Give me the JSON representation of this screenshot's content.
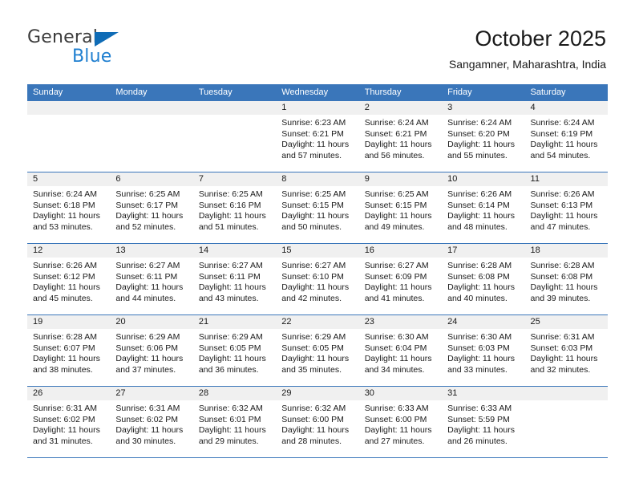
{
  "brand": {
    "name_top": "General",
    "name_bottom": "Blue",
    "triangle_color": "#0f6cb6",
    "blue_color": "#1f7fd0"
  },
  "header": {
    "title": "October 2025",
    "subtitle": "Sangamner, Maharashtra, India"
  },
  "theme": {
    "header_blue": "#3a76ba",
    "day_band_gray": "#f0f0f0",
    "text": "#1a1a1a"
  },
  "weekdays": [
    "Sunday",
    "Monday",
    "Tuesday",
    "Wednesday",
    "Thursday",
    "Friday",
    "Saturday"
  ],
  "labels": {
    "sunrise_prefix": "Sunrise: ",
    "sunset_prefix": "Sunset: ",
    "daylight_prefix": "Daylight: "
  },
  "weeks": [
    [
      {
        "day": "",
        "empty": true
      },
      {
        "day": "",
        "empty": true
      },
      {
        "day": "",
        "empty": true
      },
      {
        "day": "1",
        "sunrise": "Sunrise: 6:23 AM",
        "sunset": "Sunset: 6:21 PM",
        "daylight_line1": "Daylight: 11 hours",
        "daylight_line2": "and 57 minutes."
      },
      {
        "day": "2",
        "sunrise": "Sunrise: 6:24 AM",
        "sunset": "Sunset: 6:21 PM",
        "daylight_line1": "Daylight: 11 hours",
        "daylight_line2": "and 56 minutes."
      },
      {
        "day": "3",
        "sunrise": "Sunrise: 6:24 AM",
        "sunset": "Sunset: 6:20 PM",
        "daylight_line1": "Daylight: 11 hours",
        "daylight_line2": "and 55 minutes."
      },
      {
        "day": "4",
        "sunrise": "Sunrise: 6:24 AM",
        "sunset": "Sunset: 6:19 PM",
        "daylight_line1": "Daylight: 11 hours",
        "daylight_line2": "and 54 minutes."
      }
    ],
    [
      {
        "day": "5",
        "sunrise": "Sunrise: 6:24 AM",
        "sunset": "Sunset: 6:18 PM",
        "daylight_line1": "Daylight: 11 hours",
        "daylight_line2": "and 53 minutes."
      },
      {
        "day": "6",
        "sunrise": "Sunrise: 6:25 AM",
        "sunset": "Sunset: 6:17 PM",
        "daylight_line1": "Daylight: 11 hours",
        "daylight_line2": "and 52 minutes."
      },
      {
        "day": "7",
        "sunrise": "Sunrise: 6:25 AM",
        "sunset": "Sunset: 6:16 PM",
        "daylight_line1": "Daylight: 11 hours",
        "daylight_line2": "and 51 minutes."
      },
      {
        "day": "8",
        "sunrise": "Sunrise: 6:25 AM",
        "sunset": "Sunset: 6:15 PM",
        "daylight_line1": "Daylight: 11 hours",
        "daylight_line2": "and 50 minutes."
      },
      {
        "day": "9",
        "sunrise": "Sunrise: 6:25 AM",
        "sunset": "Sunset: 6:15 PM",
        "daylight_line1": "Daylight: 11 hours",
        "daylight_line2": "and 49 minutes."
      },
      {
        "day": "10",
        "sunrise": "Sunrise: 6:26 AM",
        "sunset": "Sunset: 6:14 PM",
        "daylight_line1": "Daylight: 11 hours",
        "daylight_line2": "and 48 minutes."
      },
      {
        "day": "11",
        "sunrise": "Sunrise: 6:26 AM",
        "sunset": "Sunset: 6:13 PM",
        "daylight_line1": "Daylight: 11 hours",
        "daylight_line2": "and 47 minutes."
      }
    ],
    [
      {
        "day": "12",
        "sunrise": "Sunrise: 6:26 AM",
        "sunset": "Sunset: 6:12 PM",
        "daylight_line1": "Daylight: 11 hours",
        "daylight_line2": "and 45 minutes."
      },
      {
        "day": "13",
        "sunrise": "Sunrise: 6:27 AM",
        "sunset": "Sunset: 6:11 PM",
        "daylight_line1": "Daylight: 11 hours",
        "daylight_line2": "and 44 minutes."
      },
      {
        "day": "14",
        "sunrise": "Sunrise: 6:27 AM",
        "sunset": "Sunset: 6:11 PM",
        "daylight_line1": "Daylight: 11 hours",
        "daylight_line2": "and 43 minutes."
      },
      {
        "day": "15",
        "sunrise": "Sunrise: 6:27 AM",
        "sunset": "Sunset: 6:10 PM",
        "daylight_line1": "Daylight: 11 hours",
        "daylight_line2": "and 42 minutes."
      },
      {
        "day": "16",
        "sunrise": "Sunrise: 6:27 AM",
        "sunset": "Sunset: 6:09 PM",
        "daylight_line1": "Daylight: 11 hours",
        "daylight_line2": "and 41 minutes."
      },
      {
        "day": "17",
        "sunrise": "Sunrise: 6:28 AM",
        "sunset": "Sunset: 6:08 PM",
        "daylight_line1": "Daylight: 11 hours",
        "daylight_line2": "and 40 minutes."
      },
      {
        "day": "18",
        "sunrise": "Sunrise: 6:28 AM",
        "sunset": "Sunset: 6:08 PM",
        "daylight_line1": "Daylight: 11 hours",
        "daylight_line2": "and 39 minutes."
      }
    ],
    [
      {
        "day": "19",
        "sunrise": "Sunrise: 6:28 AM",
        "sunset": "Sunset: 6:07 PM",
        "daylight_line1": "Daylight: 11 hours",
        "daylight_line2": "and 38 minutes."
      },
      {
        "day": "20",
        "sunrise": "Sunrise: 6:29 AM",
        "sunset": "Sunset: 6:06 PM",
        "daylight_line1": "Daylight: 11 hours",
        "daylight_line2": "and 37 minutes."
      },
      {
        "day": "21",
        "sunrise": "Sunrise: 6:29 AM",
        "sunset": "Sunset: 6:05 PM",
        "daylight_line1": "Daylight: 11 hours",
        "daylight_line2": "and 36 minutes."
      },
      {
        "day": "22",
        "sunrise": "Sunrise: 6:29 AM",
        "sunset": "Sunset: 6:05 PM",
        "daylight_line1": "Daylight: 11 hours",
        "daylight_line2": "and 35 minutes."
      },
      {
        "day": "23",
        "sunrise": "Sunrise: 6:30 AM",
        "sunset": "Sunset: 6:04 PM",
        "daylight_line1": "Daylight: 11 hours",
        "daylight_line2": "and 34 minutes."
      },
      {
        "day": "24",
        "sunrise": "Sunrise: 6:30 AM",
        "sunset": "Sunset: 6:03 PM",
        "daylight_line1": "Daylight: 11 hours",
        "daylight_line2": "and 33 minutes."
      },
      {
        "day": "25",
        "sunrise": "Sunrise: 6:31 AM",
        "sunset": "Sunset: 6:03 PM",
        "daylight_line1": "Daylight: 11 hours",
        "daylight_line2": "and 32 minutes."
      }
    ],
    [
      {
        "day": "26",
        "sunrise": "Sunrise: 6:31 AM",
        "sunset": "Sunset: 6:02 PM",
        "daylight_line1": "Daylight: 11 hours",
        "daylight_line2": "and 31 minutes."
      },
      {
        "day": "27",
        "sunrise": "Sunrise: 6:31 AM",
        "sunset": "Sunset: 6:02 PM",
        "daylight_line1": "Daylight: 11 hours",
        "daylight_line2": "and 30 minutes."
      },
      {
        "day": "28",
        "sunrise": "Sunrise: 6:32 AM",
        "sunset": "Sunset: 6:01 PM",
        "daylight_line1": "Daylight: 11 hours",
        "daylight_line2": "and 29 minutes."
      },
      {
        "day": "29",
        "sunrise": "Sunrise: 6:32 AM",
        "sunset": "Sunset: 6:00 PM",
        "daylight_line1": "Daylight: 11 hours",
        "daylight_line2": "and 28 minutes."
      },
      {
        "day": "30",
        "sunrise": "Sunrise: 6:33 AM",
        "sunset": "Sunset: 6:00 PM",
        "daylight_line1": "Daylight: 11 hours",
        "daylight_line2": "and 27 minutes."
      },
      {
        "day": "31",
        "sunrise": "Sunrise: 6:33 AM",
        "sunset": "Sunset: 5:59 PM",
        "daylight_line1": "Daylight: 11 hours",
        "daylight_line2": "and 26 minutes."
      },
      {
        "day": "",
        "empty": true
      }
    ]
  ]
}
